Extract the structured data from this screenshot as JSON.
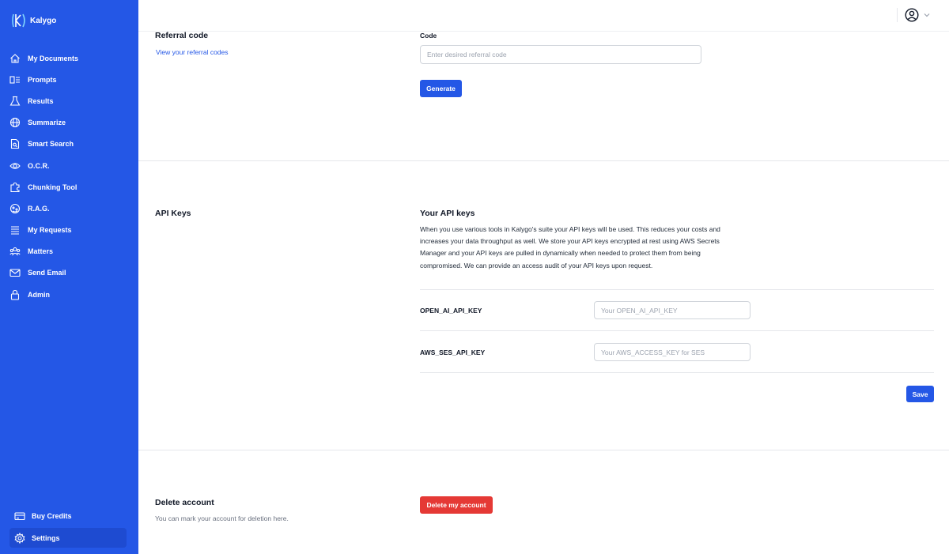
{
  "app": {
    "name": "Kalygo",
    "accent": "#2457e6",
    "danger": "#e53935"
  },
  "sidebar": {
    "items": [
      {
        "label": "My Documents",
        "icon": "home-icon"
      },
      {
        "label": "Prompts",
        "icon": "prompts-icon"
      },
      {
        "label": "Results",
        "icon": "flask-icon"
      },
      {
        "label": "Summarize",
        "icon": "globe-icon"
      },
      {
        "label": "Smart Search",
        "icon": "document-search-icon"
      },
      {
        "label": "O.C.R.",
        "icon": "eye-icon"
      },
      {
        "label": "Chunking Tool",
        "icon": "puzzle-icon"
      },
      {
        "label": "R.A.G.",
        "icon": "bug-icon"
      },
      {
        "label": "My Requests",
        "icon": "list-icon"
      },
      {
        "label": "Matters",
        "icon": "users-icon"
      },
      {
        "label": "Send Email",
        "icon": "mail-icon"
      },
      {
        "label": "Admin",
        "icon": "lock-icon"
      }
    ],
    "bottom": [
      {
        "label": "Buy Credits",
        "icon": "credit-card-icon"
      },
      {
        "label": "Settings",
        "icon": "gear-icon"
      }
    ]
  },
  "referral": {
    "title": "Referral code",
    "link": "View your referral codes",
    "code_label": "Code",
    "placeholder": "Enter desired referral code",
    "generate": "Generate"
  },
  "api_keys": {
    "title": "API Keys",
    "subtitle": "Your API keys",
    "description": "When you use various tools in Kalygo's suite your API keys will be used. This reduces your costs and increases your data throughput as well. We store your API keys encrypted at rest using AWS Secrets Manager and your API keys are pulled in dynamically when needed to protect them from being compromised. We can provide an access audit of your API keys upon request.",
    "openai_label": "OPEN_AI_API_KEY",
    "openai_placeholder": "Your OPEN_AI_API_KEY",
    "aws_label": "AWS_SES_API_KEY",
    "aws_placeholder": "Your AWS_ACCESS_KEY for SES",
    "save": "Save"
  },
  "delete_account": {
    "title": "Delete account",
    "description": "You can mark your account for deletion here.",
    "button": "Delete my account"
  }
}
